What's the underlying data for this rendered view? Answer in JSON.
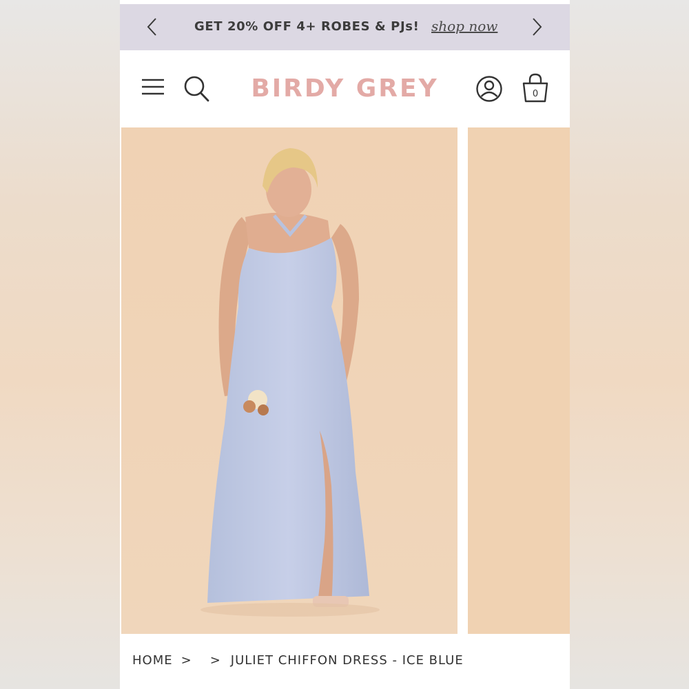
{
  "promo": {
    "text": "GET 20% OFF 4+ ROBES & PJs!",
    "link": "shop now",
    "prev_icon": "chevron-left-icon",
    "next_icon": "chevron-right-icon",
    "background": "#dcd8e3"
  },
  "header": {
    "logo": "BIRDY GREY",
    "logo_color": "#e3aaa6",
    "menu_icon": "hamburger-menu-icon",
    "search_icon": "search-icon",
    "account_icon": "account-icon",
    "cart_icon": "shopping-bag-icon",
    "cart_count": "0"
  },
  "gallery": {
    "main_image": "model wearing ice blue halter chiffon gown holding bouquet",
    "background": "#f0d2b2"
  },
  "breadcrumb": {
    "items": [
      "HOME",
      "",
      "JULIET CHIFFON DRESS - ICE BLUE"
    ],
    "separator": ">"
  }
}
